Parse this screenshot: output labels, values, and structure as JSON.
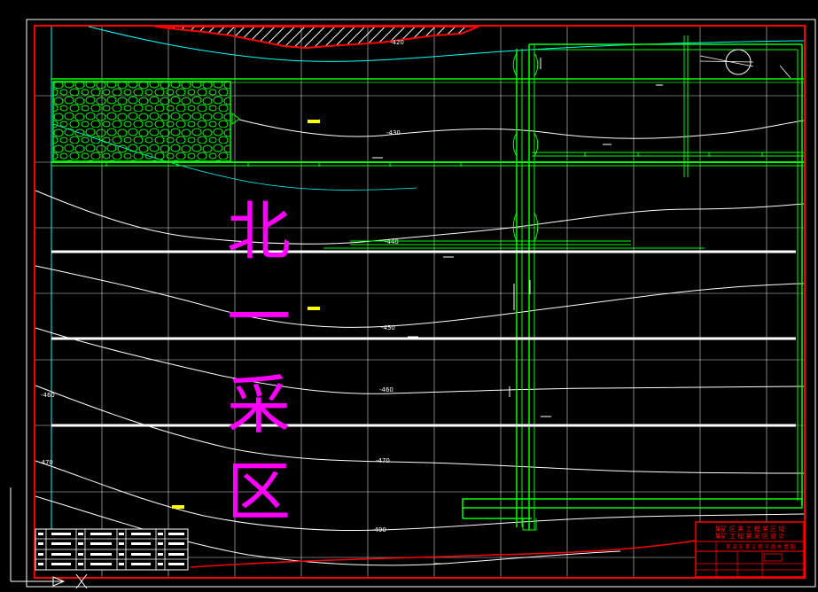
{
  "drawing": {
    "zone_label": [
      "北",
      "一",
      "采",
      "区"
    ],
    "colors": {
      "background": "#000000",
      "frame": "#ff0000",
      "grid": "#ffffff",
      "contour": "#ffffff",
      "cyan": "#00ffff",
      "structure": "#00ff00",
      "label": "#ff00ff",
      "marker": "#ffff00"
    },
    "contour_labels": [
      "-490",
      "-470",
      "-460",
      "-450",
      "-440",
      "-430",
      "-420"
    ],
    "title_block_lines": [
      "某矿 区 某 工 程 某 区 域",
      "某矿 工 程 某 采 区 设 计",
      "某 采 区 某 工 程 平 面 布 置 图"
    ]
  }
}
